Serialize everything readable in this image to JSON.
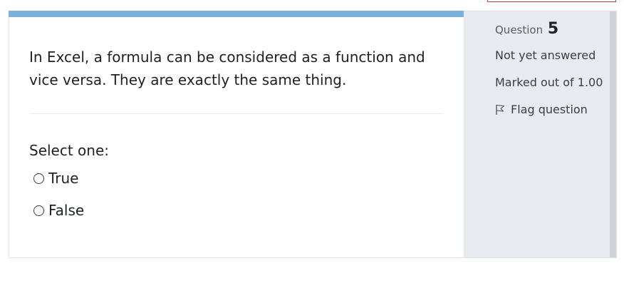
{
  "question": {
    "text": "In Excel, a formula can be considered as a function and vice versa. They are exactly the same thing.",
    "select_prompt": "Select one:",
    "options": [
      {
        "label": "True",
        "selected": false
      },
      {
        "label": "False",
        "selected": false
      }
    ]
  },
  "info": {
    "question_word": "Question",
    "question_number": "5",
    "state": "Not yet answered",
    "grade": "Marked out of 1.00",
    "flag_label": "Flag question",
    "flag_icon": "flag-outline-icon"
  },
  "colors": {
    "accent_bar": "#7ab1d9",
    "info_bg": "#e7eaee"
  }
}
